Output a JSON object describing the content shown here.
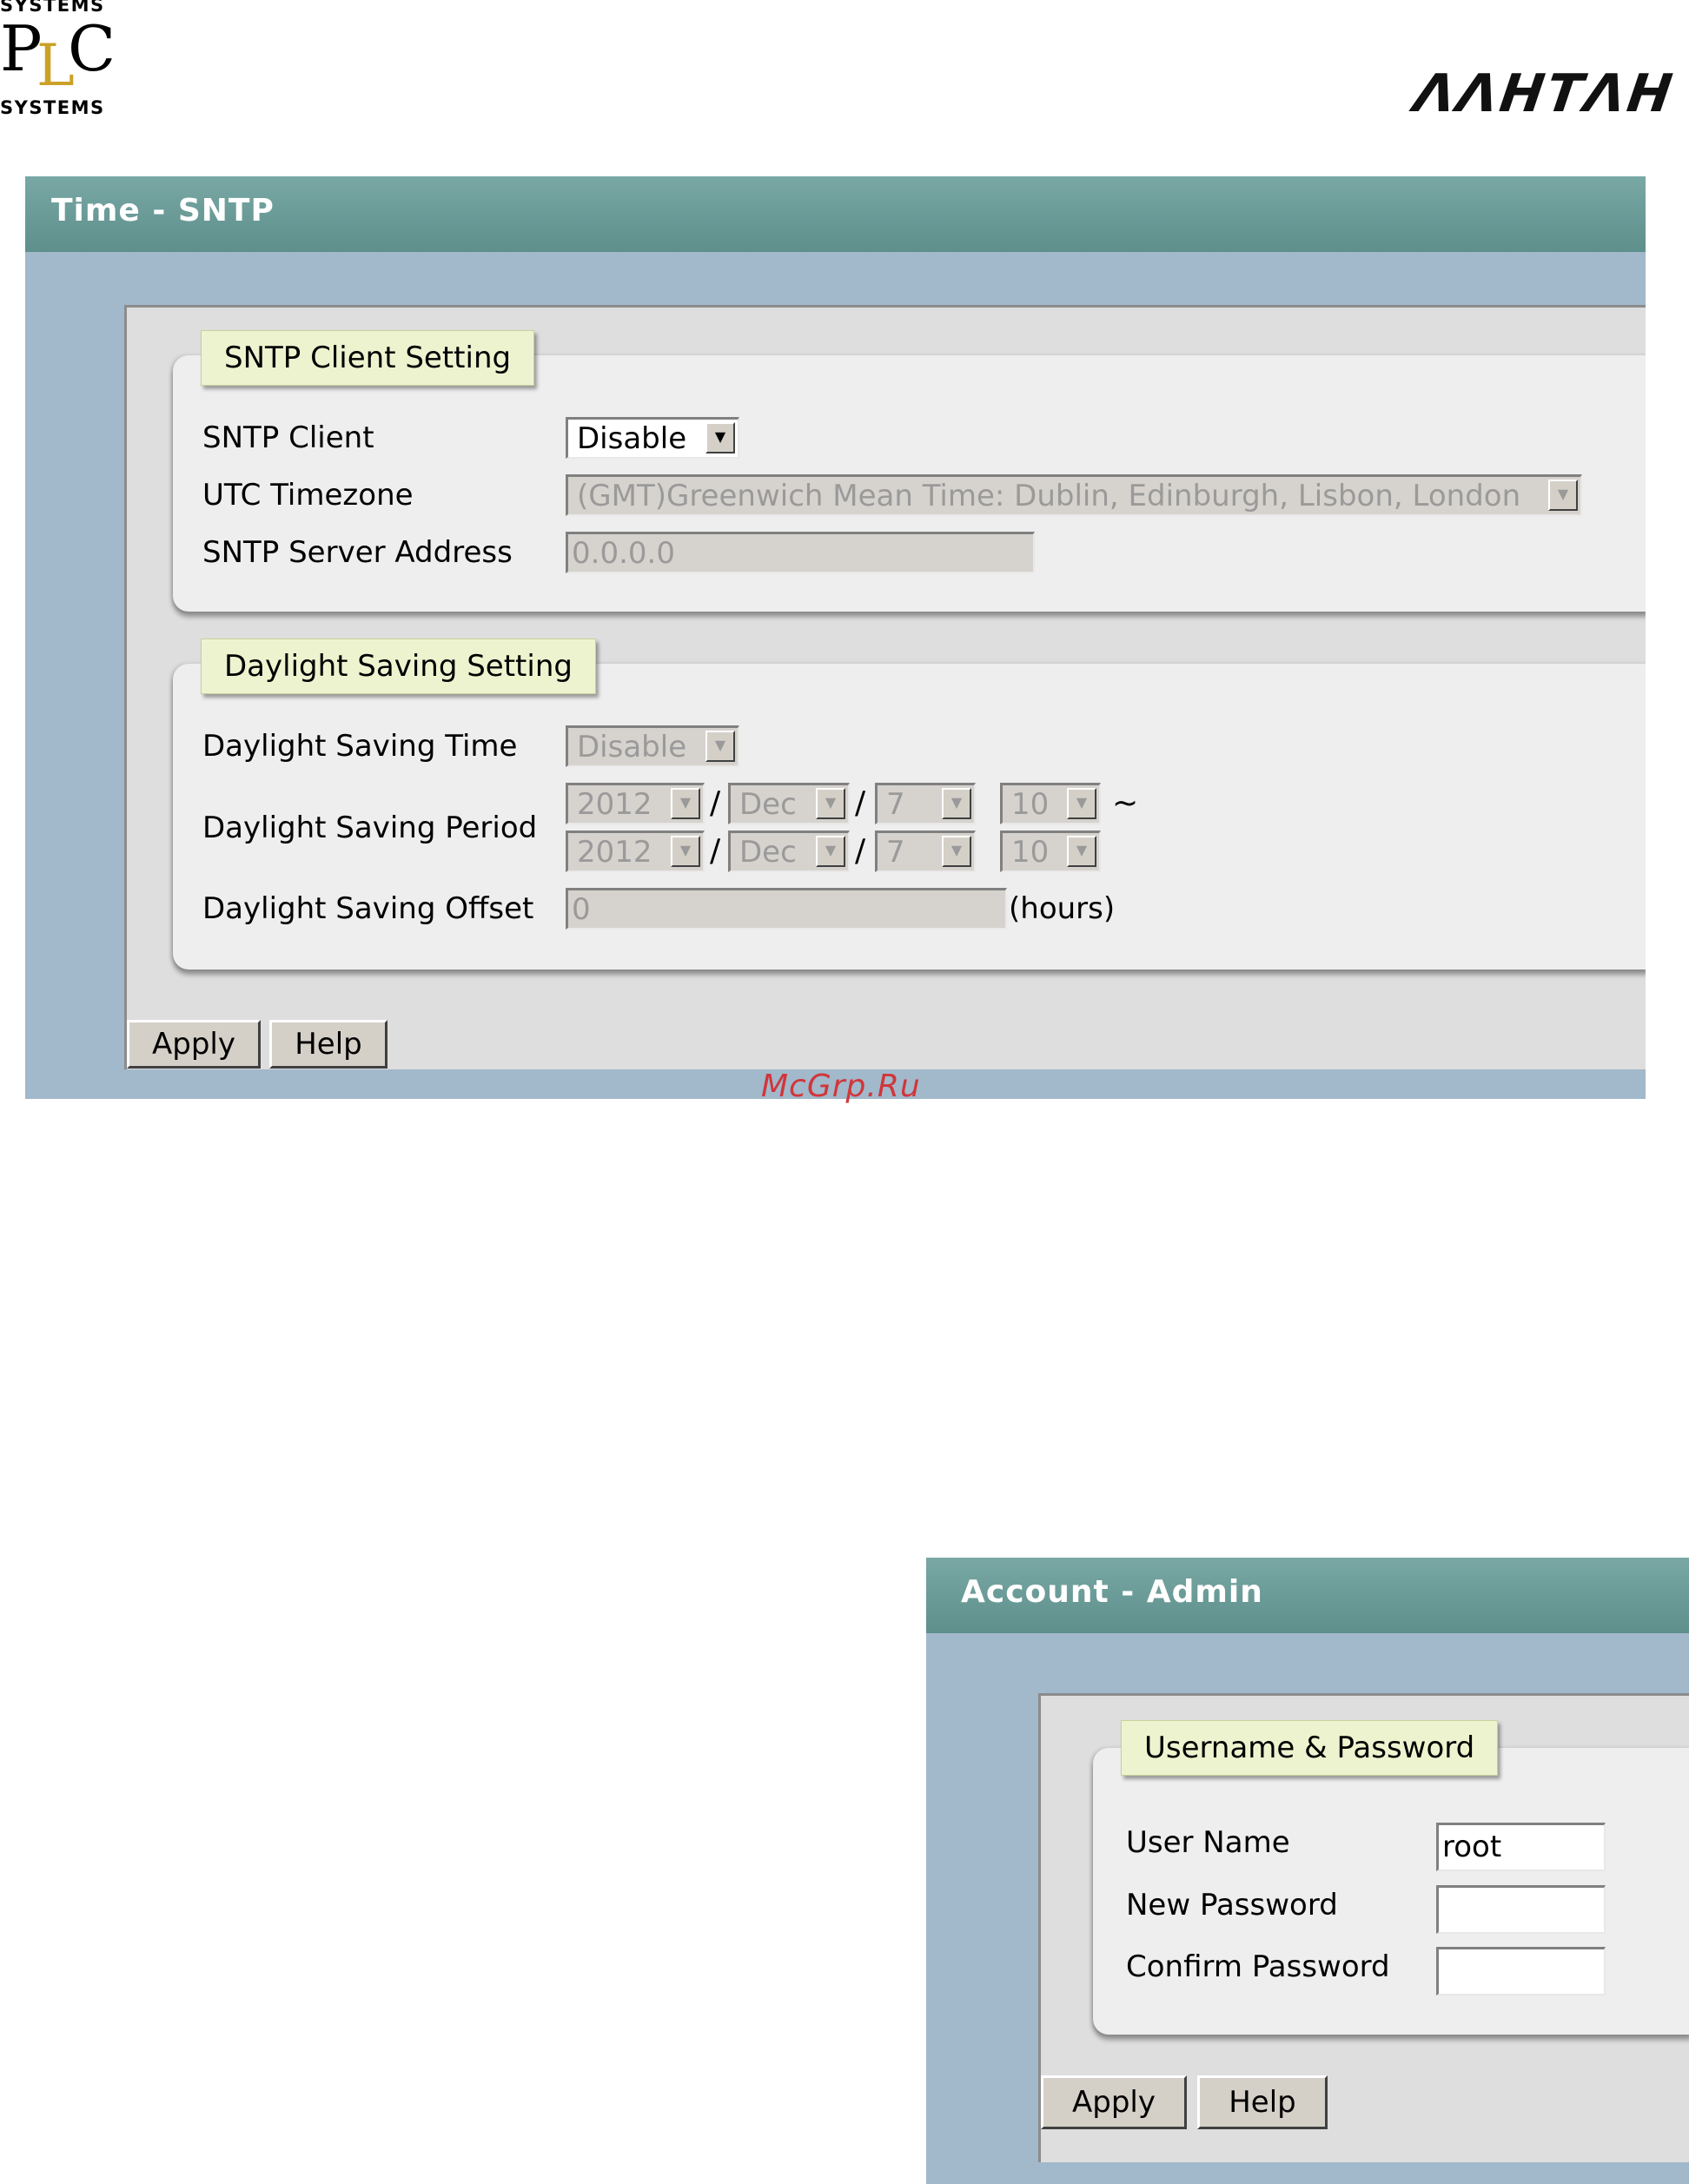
{
  "logos": {
    "plc": {
      "top_text": "SYSTEMS",
      "letters": [
        "P",
        "L",
        "C"
      ],
      "bottom_text": "SYSTEMS"
    },
    "brand": "ΛΛΗΤΛΗ"
  },
  "sntp_panel": {
    "title": "Time - SNTP",
    "client_section": {
      "legend": "SNTP Client Setting",
      "sntp_client": {
        "label": "SNTP Client",
        "value": "Disable"
      },
      "utc_timezone": {
        "label": "UTC Timezone",
        "value": "(GMT)Greenwich Mean Time: Dublin, Edinburgh, Lisbon, London"
      },
      "server_address": {
        "label": "SNTP Server Address",
        "value": "0.0.0.0"
      }
    },
    "dst_section": {
      "legend": "Daylight Saving Setting",
      "dst_time": {
        "label": "Daylight Saving Time",
        "value": "Disable"
      },
      "dst_period": {
        "label": "Daylight Saving Period",
        "start": {
          "year": "2012",
          "month": "Dec",
          "day": "7",
          "hour": "10"
        },
        "end": {
          "year": "2012",
          "month": "Dec",
          "day": "7",
          "hour": "10"
        },
        "separator": "/",
        "range_symbol": "~"
      },
      "dst_offset": {
        "label": "Daylight Saving Offset",
        "value": "0",
        "unit": "(hours)"
      }
    },
    "buttons": {
      "apply": "Apply",
      "help": "Help"
    }
  },
  "watermark": "McGrp.Ru",
  "admin_panel": {
    "title": "Account - Admin",
    "section": {
      "legend": "Username & Password",
      "user_name": {
        "label": "User Name",
        "value": "root"
      },
      "new_password": {
        "label": "New Password",
        "value": ""
      },
      "confirm_password": {
        "label": "Confirm Password",
        "value": ""
      }
    },
    "buttons": {
      "apply": "Apply",
      "help": "Help"
    }
  },
  "colors": {
    "panel_bg": "#a2b8cb",
    "header_bg": "#6b9c98",
    "legend_bg": "#eef3cf",
    "watermark": "#d0363a"
  }
}
